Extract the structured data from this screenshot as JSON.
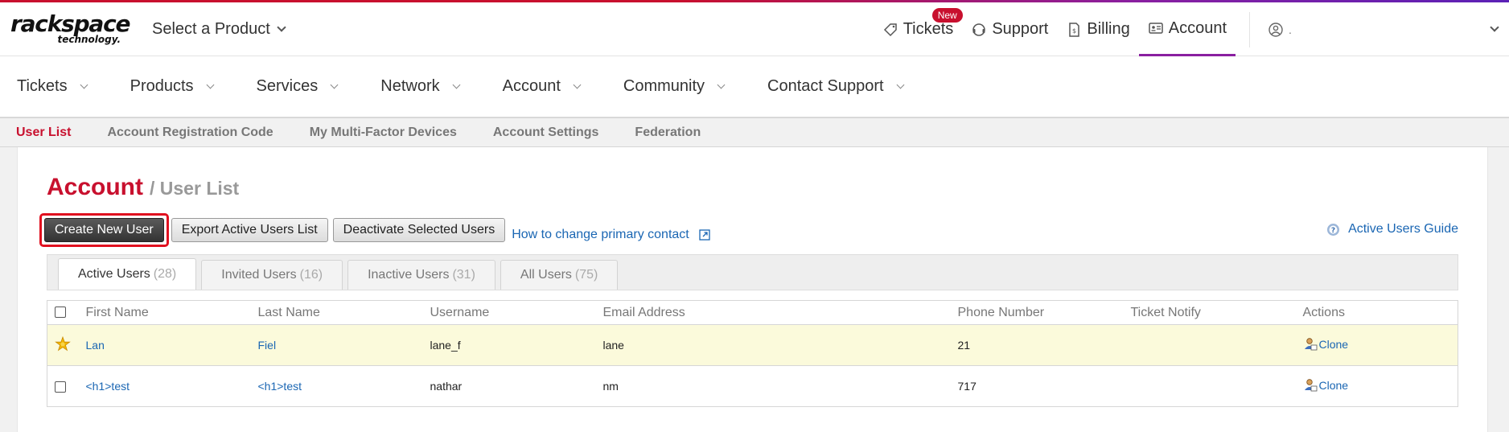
{
  "brand": {
    "logo_main": "rackspace",
    "logo_sub": "technology."
  },
  "header": {
    "product_select": "Select a Product",
    "links": [
      {
        "label": "Tickets",
        "badge": "New"
      },
      {
        "label": "Support"
      },
      {
        "label": "Billing"
      },
      {
        "label": "Account"
      }
    ],
    "user_name": "."
  },
  "main_nav": [
    "Tickets",
    "Products",
    "Services",
    "Network",
    "Account",
    "Community",
    "Contact Support"
  ],
  "sub_nav": [
    "User List",
    "Account Registration Code",
    "My Multi-Factor Devices",
    "Account Settings",
    "Federation"
  ],
  "page": {
    "title": "Account",
    "subtitle": "/ User List"
  },
  "toolbar": {
    "create": "Create New User",
    "export": "Export Active Users List",
    "deactivate": "Deactivate Selected Users",
    "help_link": "How to change primary contact",
    "guide_link": "Active Users Guide"
  },
  "tabs": [
    {
      "label": "Active Users",
      "count": "(28)"
    },
    {
      "label": "Invited Users",
      "count": "(16)"
    },
    {
      "label": "Inactive Users",
      "count": "(31)"
    },
    {
      "label": "All Users",
      "count": "(75)"
    }
  ],
  "table": {
    "columns": [
      "First Name",
      "Last Name",
      "Username",
      "Email Address",
      "Phone Number",
      "Ticket Notify",
      "Actions"
    ],
    "rows": [
      {
        "first": "Lan",
        "last": "Fiel",
        "username": "lane_f",
        "email": "lane",
        "phone": "21",
        "notify": "",
        "action": "Clone",
        "primary": true
      },
      {
        "first": "<h1>test",
        "last": "<h1>test",
        "username": "nathar",
        "email": "nm",
        "phone": "717",
        "notify": "",
        "action": "Clone",
        "primary": false
      }
    ]
  },
  "colors": {
    "brand_red": "#c8102e",
    "link_blue": "#1a66b3",
    "accent_purple": "#8a1fa0",
    "row_highlight": "#fbfadb"
  }
}
